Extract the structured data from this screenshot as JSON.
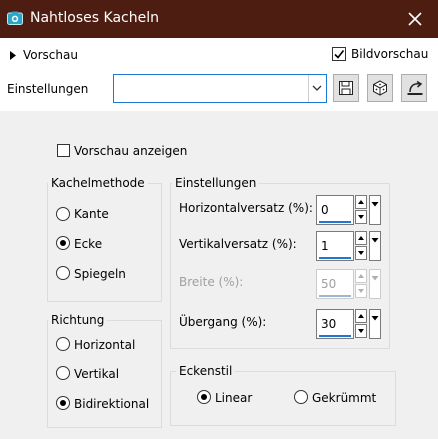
{
  "window": {
    "title": "Nahtloses Kacheln",
    "close_icon": "close-icon",
    "app_icon": "camera-icon"
  },
  "colors": {
    "titlebar": "#4e1d12",
    "accent": "#1e77d0",
    "panel": "#f0f0f0"
  },
  "preview": {
    "label": "Vorschau",
    "checkbox_label": "Bildvorschau",
    "checked": true
  },
  "settings": {
    "label": "Einstellungen",
    "value": "",
    "icons": [
      "save-preset-icon",
      "randomize-icon",
      "reset-icon"
    ]
  },
  "options": {
    "preview_on": "Vorschau anzeigen",
    "preview_on_checked": false
  },
  "tiling": {
    "title": "Kachelmethode",
    "items": [
      {
        "label": "Kante",
        "checked": false
      },
      {
        "label": "Ecke",
        "checked": true
      },
      {
        "label": "Spiegeln",
        "checked": false
      }
    ]
  },
  "direction": {
    "title": "Richtung",
    "items": [
      {
        "label": "Horizontal",
        "checked": false
      },
      {
        "label": "Vertikal",
        "checked": false
      },
      {
        "label": "Bidirektional",
        "checked": true
      }
    ]
  },
  "params": {
    "title": "Einstellungen",
    "fields": [
      {
        "label": "Horizontalversatz (%):",
        "value": "0",
        "enabled": true
      },
      {
        "label": "Vertikalversatz (%):",
        "value": "1",
        "enabled": true
      },
      {
        "label": "Breite (%):",
        "value": "50",
        "enabled": false
      },
      {
        "label": "Übergang (%):",
        "value": "30",
        "enabled": true
      }
    ]
  },
  "corner": {
    "title": "Eckenstil",
    "items": [
      {
        "label": "Linear",
        "checked": true
      },
      {
        "label": "Gekrümmt",
        "checked": false
      }
    ]
  }
}
